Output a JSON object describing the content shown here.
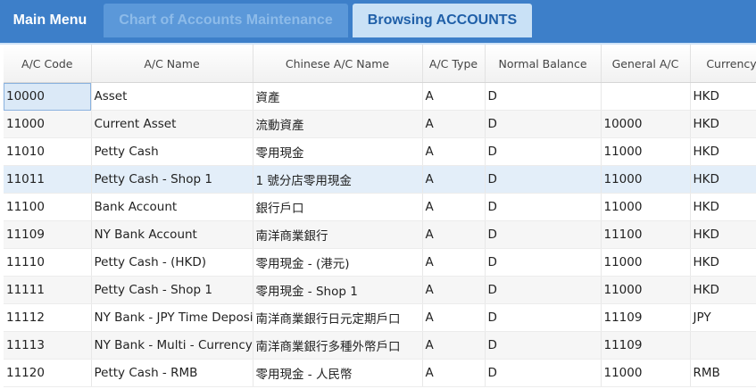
{
  "tabs": [
    {
      "label": "Main Menu"
    },
    {
      "label": "Chart of Accounts Maintenance"
    },
    {
      "label": "Browsing ACCOUNTS"
    }
  ],
  "columns": [
    "A/C Code",
    "A/C Name",
    "Chinese A/C Name",
    "A/C Type",
    "Normal Balance",
    "General A/C",
    "Currency"
  ],
  "rows": [
    [
      "10000",
      "Asset",
      "資產",
      "A",
      "D",
      "",
      "HKD"
    ],
    [
      "11000",
      "Current Asset",
      "流動資產",
      "A",
      "D",
      "10000",
      "HKD"
    ],
    [
      "11010",
      "Petty Cash",
      "零用現金",
      "A",
      "D",
      "11000",
      "HKD"
    ],
    [
      "11011",
      "Petty Cash - Shop 1",
      "1 號分店零用現金",
      "A",
      "D",
      "11000",
      "HKD"
    ],
    [
      "11100",
      "Bank Account",
      "銀行戶口",
      "A",
      "D",
      "11000",
      "HKD"
    ],
    [
      "11109",
      "NY Bank Account",
      "南洋商業銀行",
      "A",
      "D",
      "11100",
      "HKD"
    ],
    [
      "11110",
      "Petty Cash - (HKD)",
      "零用現金 - (港元)",
      "A",
      "D",
      "11000",
      "HKD"
    ],
    [
      "11111",
      "Petty Cash - Shop 1",
      "零用現金 - Shop 1",
      "A",
      "D",
      "11000",
      "HKD"
    ],
    [
      "11112",
      "NY Bank - JPY Time Deposit",
      "南洋商業銀行日元定期戶口",
      "A",
      "D",
      "11109",
      "JPY"
    ],
    [
      "11113",
      "NY Bank - Multi - Currency",
      "南洋商業銀行多種外幣戶口",
      "A",
      "D",
      "11109",
      ""
    ],
    [
      "11120",
      "Petty Cash - RMB",
      "零用現金 - 人民幣",
      "A",
      "D",
      "11000",
      "RMB"
    ]
  ],
  "colors": {
    "accent": "#3d7fc9",
    "active_tab": "#c9e1f6",
    "row_highlight": "#e3eef9"
  }
}
